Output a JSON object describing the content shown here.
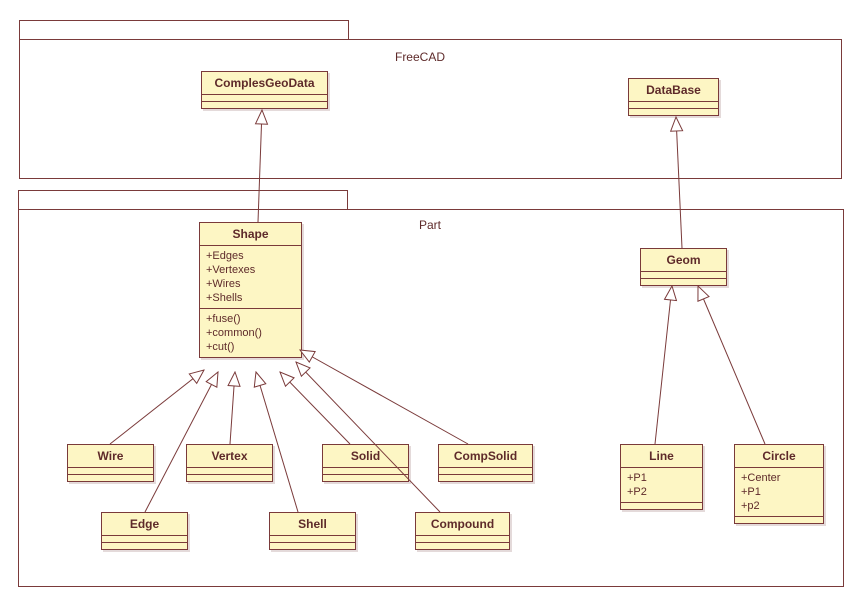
{
  "packages": {
    "freecad": {
      "label": "FreeCAD"
    },
    "part": {
      "label": "Part"
    }
  },
  "classes": {
    "complesGeoData": {
      "name": "ComplesGeoData"
    },
    "dataBase": {
      "name": "DataBase"
    },
    "shape": {
      "name": "Shape",
      "attributes": [
        "+Edges",
        "+Vertexes",
        "+Wires",
        "+Shells"
      ],
      "operations": [
        "+fuse()",
        "+common()",
        "+cut()"
      ]
    },
    "geom": {
      "name": "Geom"
    },
    "wire": {
      "name": "Wire"
    },
    "vertex": {
      "name": "Vertex"
    },
    "solid": {
      "name": "Solid"
    },
    "compSolid": {
      "name": "CompSolid"
    },
    "edge": {
      "name": "Edge"
    },
    "shell": {
      "name": "Shell"
    },
    "compound": {
      "name": "Compound"
    },
    "line": {
      "name": "Line",
      "attributes": [
        "+P1",
        "+P2"
      ]
    },
    "circle": {
      "name": "Circle",
      "attributes": [
        "+Center",
        "+P1",
        "+p2"
      ]
    }
  },
  "relationships": [
    {
      "from": "shape",
      "to": "complesGeoData",
      "type": "generalization"
    },
    {
      "from": "geom",
      "to": "dataBase",
      "type": "generalization"
    },
    {
      "from": "wire",
      "to": "shape",
      "type": "generalization"
    },
    {
      "from": "vertex",
      "to": "shape",
      "type": "generalization"
    },
    {
      "from": "solid",
      "to": "shape",
      "type": "generalization"
    },
    {
      "from": "compSolid",
      "to": "shape",
      "type": "generalization"
    },
    {
      "from": "edge",
      "to": "shape",
      "type": "generalization"
    },
    {
      "from": "shell",
      "to": "shape",
      "type": "generalization"
    },
    {
      "from": "compound",
      "to": "shape",
      "type": "generalization"
    },
    {
      "from": "line",
      "to": "geom",
      "type": "generalization"
    },
    {
      "from": "circle",
      "to": "geom",
      "type": "generalization"
    }
  ]
}
